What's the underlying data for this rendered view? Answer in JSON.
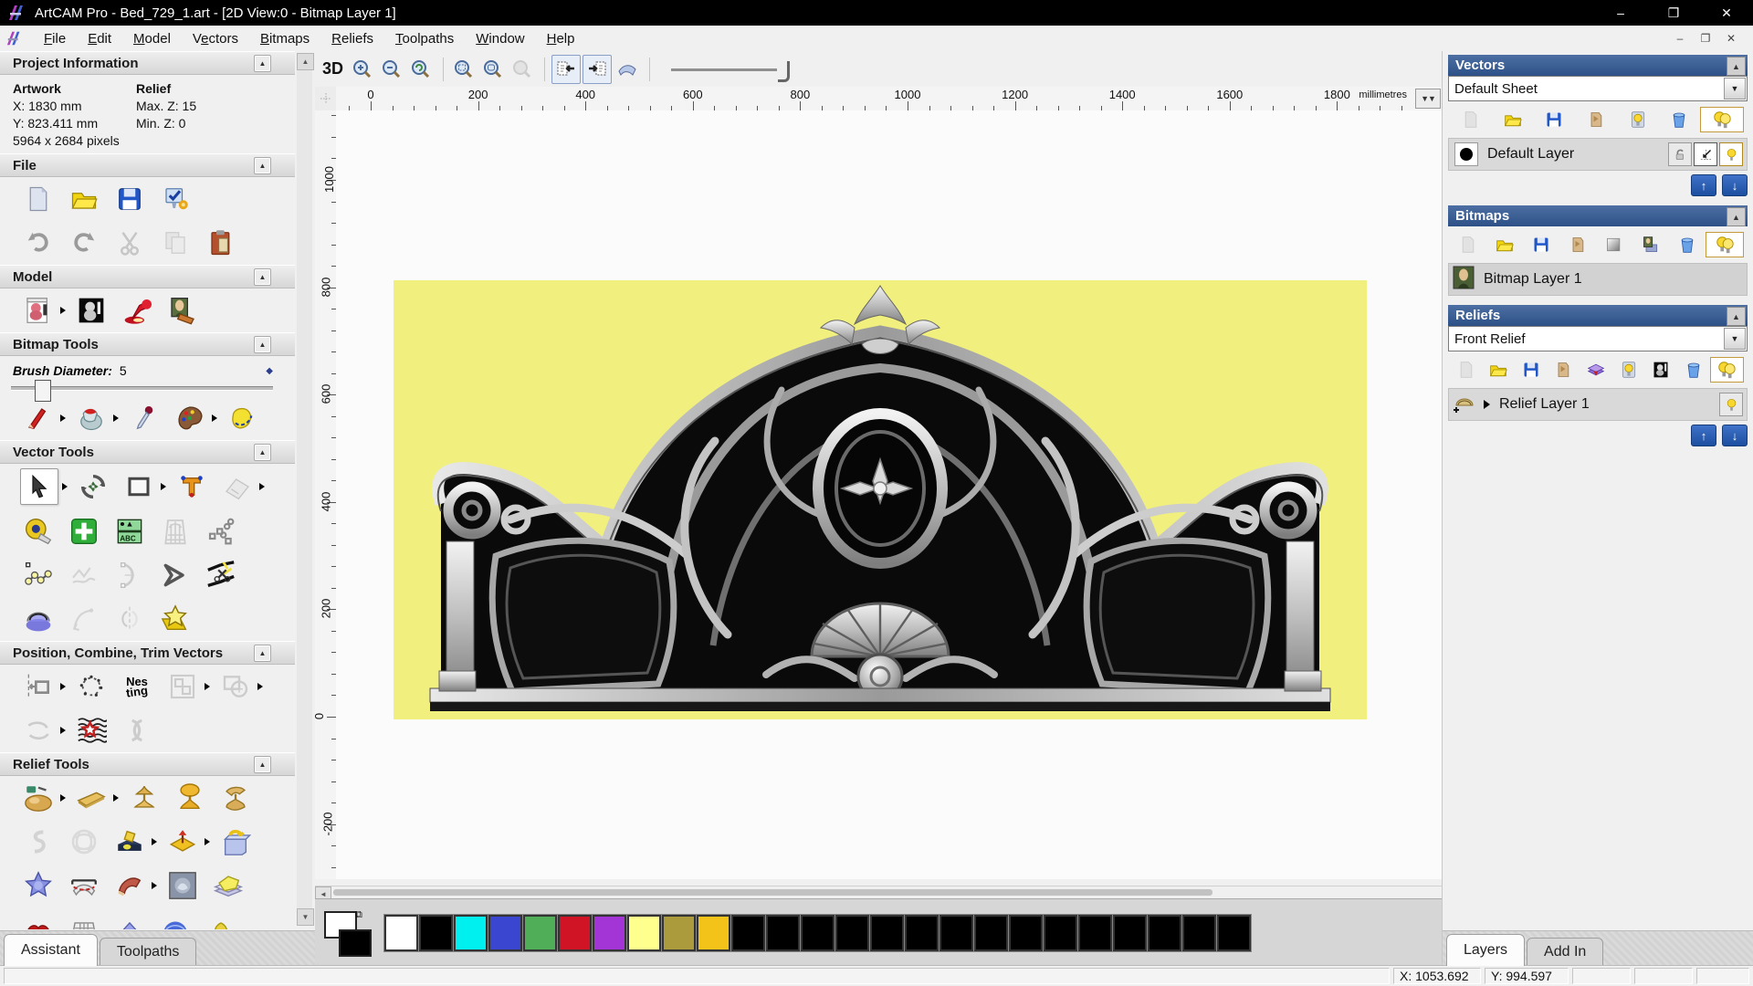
{
  "window": {
    "title": "ArtCAM Pro - Bed_729_1.art - [2D View:0 - Bitmap Layer 1]"
  },
  "menu": {
    "items": [
      {
        "label": "File",
        "u": 0
      },
      {
        "label": "Edit",
        "u": 0
      },
      {
        "label": "Model",
        "u": 0
      },
      {
        "label": "Vectors",
        "u": 1
      },
      {
        "label": "Bitmaps",
        "u": 0
      },
      {
        "label": "Reliefs",
        "u": 0
      },
      {
        "label": "Toolpaths",
        "u": 0
      },
      {
        "label": "Window",
        "u": 0
      },
      {
        "label": "Help",
        "u": 0
      }
    ]
  },
  "icons": {
    "minimize": "–",
    "maximize": "❐",
    "close": "✕",
    "mdi_minimize": "–",
    "mdi_restore": "❐",
    "mdi_close": "✕",
    "collapse": "▲",
    "scroll_up": "▲",
    "scroll_down": "▼",
    "scroll_left": "◄",
    "dropdown": "▼",
    "double_chevron": "▼▼",
    "up_arrow": "↑",
    "down_arrow": "↓",
    "link": "⧉"
  },
  "assistant": {
    "tabs": [
      {
        "label": "Assistant",
        "active": true
      },
      {
        "label": "Toolpaths",
        "active": false
      }
    ],
    "project_information": {
      "title": "Project Information",
      "artwork_label": "Artwork",
      "relief_label": "Relief",
      "x": "X: 1830 mm",
      "y": "Y: 823.411 mm",
      "pixels": "5964 x 2684 pixels",
      "max_z": "Max. Z: 15",
      "min_z": "Min. Z: 0"
    },
    "file_section": {
      "title": "File"
    },
    "model_section": {
      "title": "Model"
    },
    "bitmap_tools": {
      "title": "Bitmap Tools",
      "brush_label": "Brush Diameter:",
      "brush_value": "5"
    },
    "vector_tools": {
      "title": "Vector Tools",
      "abc_text": "ABC"
    },
    "position_combine": {
      "title": "Position, Combine, Trim Vectors",
      "nesting_line1": "Nes",
      "nesting_line2": "ting"
    },
    "relief_tools": {
      "title": "Relief Tools"
    }
  },
  "view_toolbar": {
    "mode_3d": "3D"
  },
  "ruler": {
    "h_ticks": [
      "0",
      "200",
      "400",
      "600",
      "800",
      "1000",
      "1200",
      "1400",
      "1600",
      "1800"
    ],
    "units": "millimetres",
    "v_ticks": [
      "1000",
      "800",
      "600",
      "400",
      "200",
      "0",
      "-200"
    ]
  },
  "right_panel": {
    "vectors": {
      "title": "Vectors",
      "sheet": "Default Sheet",
      "layer": "Default Layer"
    },
    "bitmaps": {
      "title": "Bitmaps",
      "layer": "Bitmap Layer 1"
    },
    "reliefs": {
      "title": "Reliefs",
      "relief": "Front Relief",
      "layer": "Relief Layer 1"
    },
    "tabs": [
      {
        "label": "Layers",
        "active": true
      },
      {
        "label": "Add In",
        "active": false
      }
    ]
  },
  "palette": {
    "swatches": [
      "#ffffff",
      "#000000",
      "#00f0f0",
      "#3a46d0",
      "#4fae57",
      "#d01325",
      "#a335d6",
      "#ffff8e",
      "#ac9b3c",
      "#f4c31a",
      "#000000",
      "#000000",
      "#000000",
      "#000000",
      "#000000",
      "#000000",
      "#000000",
      "#000000",
      "#000000",
      "#000000",
      "#000000",
      "#000000",
      "#000000",
      "#000000",
      "#000000"
    ],
    "primary": "#ffffff",
    "secondary": "#000000"
  },
  "statusbar": {
    "x": "X: 1053.692",
    "y": "Y: 994.597"
  },
  "colors": {
    "header_blue": "#2d5187",
    "canvas_yellow": "#f1ef7d",
    "titlebar": "#000000"
  }
}
